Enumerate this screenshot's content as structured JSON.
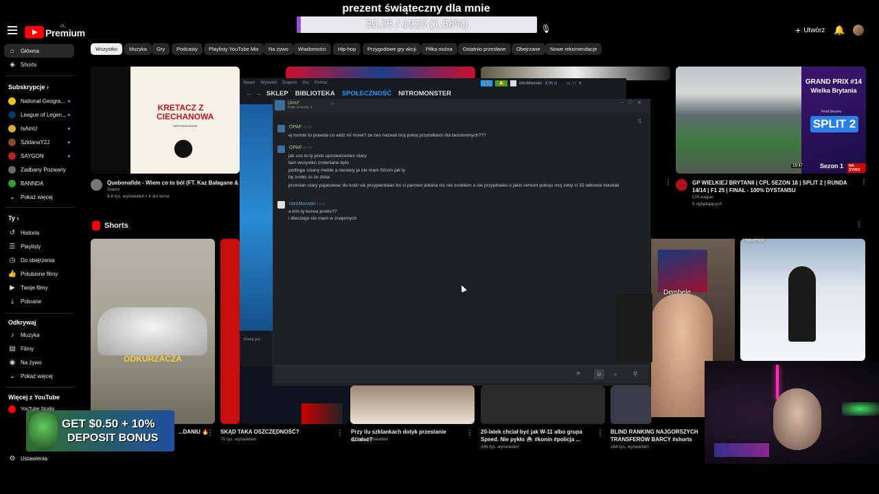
{
  "banner": {
    "title": "prezent świąteczny dla mnie",
    "progress_text": "30.25 / 1920 (1.58%)",
    "progress_fraction": 0.0158
  },
  "header": {
    "premium_label": "Premium",
    "premium_region": "PL",
    "create_label": "Utwórz"
  },
  "sidebar": {
    "main": [
      {
        "label": "Główna",
        "icon": "home-icon"
      },
      {
        "label": "Shorts",
        "icon": "shorts-icon"
      }
    ],
    "subs_heading": "Subskrypcje",
    "subs": [
      {
        "label": "National Geogra...",
        "color": "#f2c500"
      },
      {
        "label": "League of Legen...",
        "color": "#0a3a5a"
      },
      {
        "label": "IsAmU",
        "color": "#d8b030"
      },
      {
        "label": "SzklanaY2J",
        "color": "#8a4a2a"
      },
      {
        "label": "SAYGON",
        "color": "#c02020"
      },
      {
        "label": "Zadbany Pozwany",
        "color": "#6a6a6a"
      },
      {
        "label": "BANNDA",
        "color": "#30a030"
      }
    ],
    "subs_more": "Pokaż więcej",
    "you_heading": "Ty",
    "you": [
      {
        "label": "Historia"
      },
      {
        "label": "Playlisty"
      },
      {
        "label": "Do obejrzenia"
      },
      {
        "label": "Polubione filmy"
      },
      {
        "label": "Twoje filmy"
      },
      {
        "label": "Pobrane"
      }
    ],
    "explore_heading": "Odkrywaj",
    "explore": [
      {
        "label": "Muzyka"
      },
      {
        "label": "Filmy"
      },
      {
        "label": "Na żywo"
      }
    ],
    "explore_more": "Pokaż więcej",
    "more_heading": "Więcej z YouTube",
    "more": [
      {
        "label": "YouTube Studio"
      }
    ],
    "settings": "Ustawienia"
  },
  "chips": [
    "Wszystko",
    "Muzyka",
    "Gry",
    "Podcasty",
    "Playlisty YouTube Mix",
    "Na żywo",
    "Wiadomości",
    "Hip-hop",
    "Przygodowe gry akcji",
    "Piłka nożna",
    "Ostatnio przesłane",
    "Obejrzane",
    "Nowe rekomendacje"
  ],
  "videos": {
    "v1": {
      "thumb_title": "KRETACZ Z CIECHANOWA",
      "thumb_sub": "NIEPUBLIKOWANE",
      "title": "Quebonafide - Wiem co to ból (FT. Kaz Bałagane & Ser",
      "channel": "Swero",
      "meta": "8,8 tys. wyświetleń • 4 dni temu"
    },
    "v4": {
      "thumb_title": "GRAND PRIX #14",
      "thumb_sub": "Wielka Brytania",
      "thumb_badge": "SPLIT 2",
      "thumb_final": "Finał Sezonu",
      "thumb_season": "Sezon 1",
      "live_badge": "NA ŻYWO",
      "duration": "16:47",
      "title": "GP WIELKIEJ BRYTANII | CPL SEZON 18 | SPLIT 2 | RUNDA 14/14 | F1 25 | FINAŁ - 100% DYSTANSU",
      "channel": "CPLeague",
      "meta": "5 oglądających"
    }
  },
  "shorts": {
    "heading": "Shorts",
    "s1_overlay": "ODKURZACZA",
    "s5_overlay": "Dembele",
    "s6_overlay": "challenge",
    "items": [
      {
        "title": "...DANIU 🔥",
        "meta": ""
      },
      {
        "title": "SKĄD TAKA OSZCZĘDNOŚĆ?",
        "meta": "70 tys. wyświetleń"
      },
      {
        "title": "Przy ilu szklankach dotyk przestanie działać?",
        "meta": "1,7 mln wyświetleń"
      },
      {
        "title": "20-latek chciał być jak W-11 albo grupa Speed. Nie pykło 🚔 #konin #policja ...",
        "meta": "346 tys. wyświetleń"
      },
      {
        "title": "BLIND RANKING NAJGORSZYCH TRANSFERÓW BARCY #shorts",
        "meta": "164 tys. wyświetleń"
      }
    ]
  },
  "steam": {
    "menu": [
      "Steam",
      "Wyświetl",
      "Znajomi",
      "Gry",
      "Pomoc"
    ],
    "nav": [
      "SKLEP",
      "BIBLIOTEKA",
      "SPOŁECZNOŚĆ",
      "NITROMONSTER"
    ],
    "active_nav": "SPOŁECZNOŚĆ",
    "account": "nitroMonster",
    "balance": "4,06 zł",
    "add_game": "Dodaj grę"
  },
  "chat": {
    "tab_name": "OPAF",
    "tab_game": "Path of Exile 2",
    "messages": [
      {
        "author": "OPAF",
        "time": "23:09",
        "color": "#a8d07a",
        "lines": [
          "ej mordo to prawda co widz mi mowi? ze zes nazwal moj pokoj przytulkiem dla bezdomnych???"
        ]
      },
      {
        "author": "OPAF",
        "time": "23:09",
        "color": "#a8d07a",
        "lines": [
          "jak cos to ty jests uposledzeniec stary",
          "tam wszystko zmieniane bylo",
          "podloga sciany meble a niestety ja nie mam 50mln jak ty",
          "by zrobic to ze zlota",
          "przestan stary pajacowac do ludzi sie przypierdalac bo ci parowo jebana nic nie zrobilem a sie przyjebales o jakis remont pokoju moj zeby ci 15 latkowie klaskali"
        ]
      },
      {
        "author": "nitroMonster",
        "time": "23:10",
        "color": "#62a7e3",
        "lines": [
          "a kim ty kurwa jestes??",
          "i dlaczego cie mam w znajomych"
        ]
      }
    ]
  },
  "casino": {
    "line1": "GET $0.50 + 10%",
    "line2": "DEPOSIT BONUS"
  },
  "colors": {
    "yt_red": "#ff0000",
    "steam_blue": "#1a9fff",
    "progress": "#9b4fd6",
    "online_green": "#a8d07a"
  }
}
